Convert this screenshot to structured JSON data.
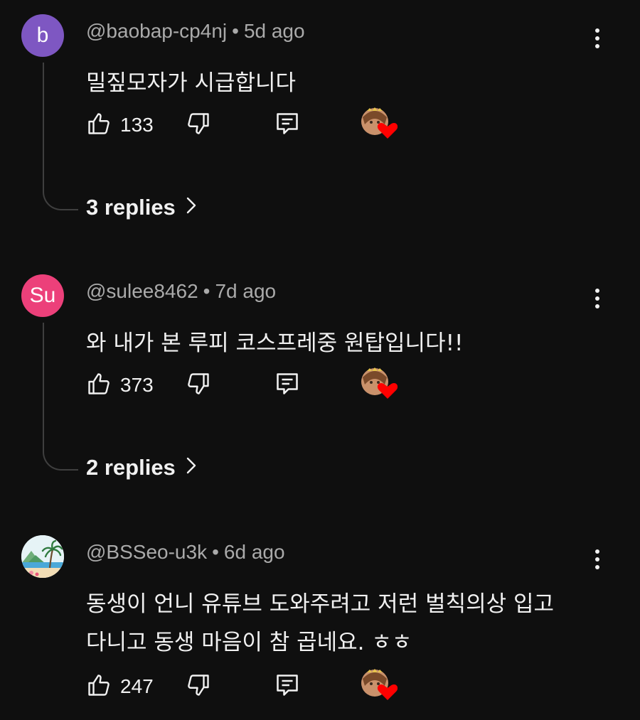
{
  "comments": [
    {
      "avatar_letter": "b",
      "avatar_color": "#7e57c2",
      "author": "@baobap-cp4nj",
      "time": "5d ago",
      "separator": "•",
      "lines": [
        "밀짚모자가 시급합니다"
      ],
      "likes": "133",
      "creator_heart": true,
      "replies_label": "3 replies"
    },
    {
      "avatar_letter": "Su",
      "avatar_color": "#ec407a",
      "author": "@sulee8462",
      "time": "7d ago",
      "separator": "•",
      "lines": [
        "와 내가 본 루피 코스프레중 원탑입니다!!"
      ],
      "likes": "373",
      "creator_heart": true,
      "replies_label": "2 replies"
    },
    {
      "avatar_image": "beach-palm-tree-avatar",
      "author": "@BSSeo-u3k",
      "time": "6d ago",
      "separator": "•",
      "lines": [
        "동생이 언니 유튜브 도와주려고 저런 벌칙의상 입고",
        "다니고 동생 마음이 참 곱네요. ㅎㅎ"
      ],
      "likes": "247",
      "creator_heart": true
    }
  ],
  "icons": {
    "like": "thumbs-up-icon",
    "dislike": "thumbs-down-icon",
    "reply": "reply-comment-icon",
    "menu": "more-vertical-icon",
    "heart": "creator-heart-icon",
    "chevron": "chevron-right-icon"
  },
  "colors": {
    "background": "#0f0f0f",
    "text_primary": "#f1f1f1",
    "text_secondary": "#aaaaaa",
    "heart": "#ff0000",
    "thread_line": "#3f3f3f"
  }
}
